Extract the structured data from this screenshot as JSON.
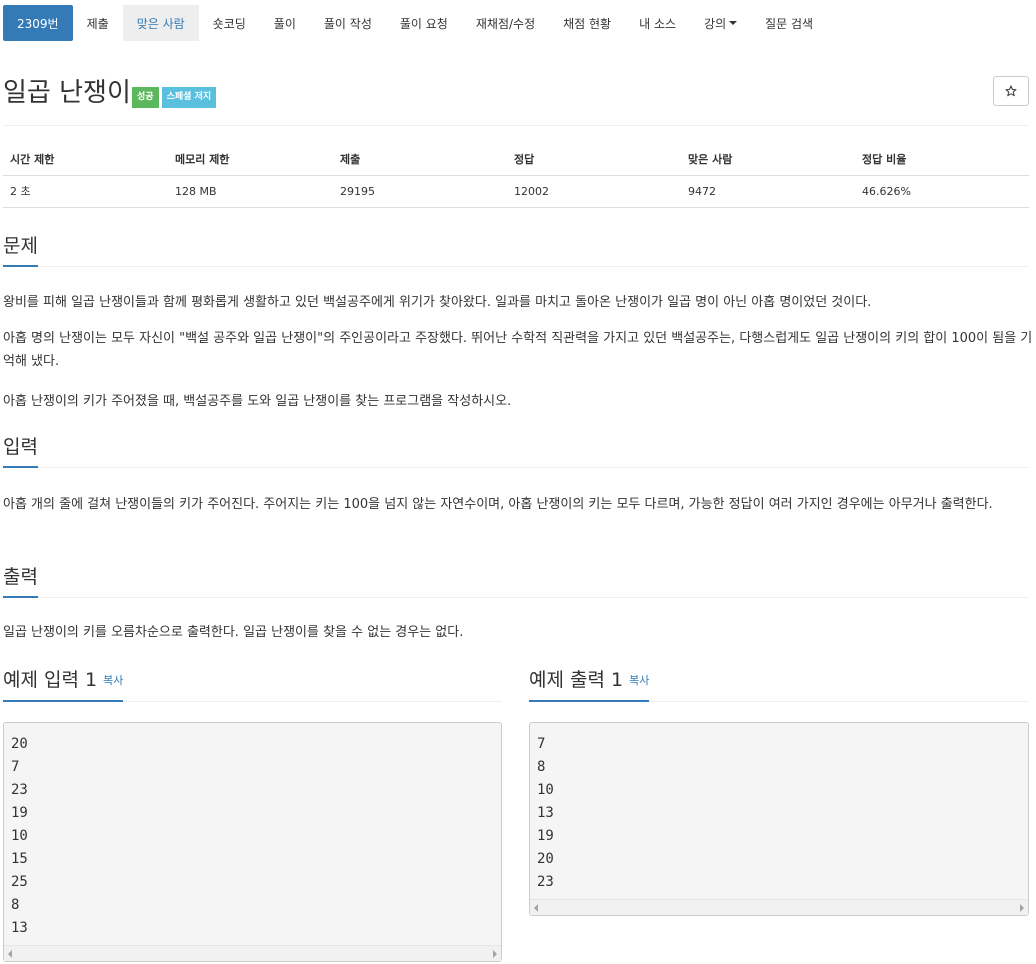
{
  "nav": {
    "items": [
      {
        "label": "2309번",
        "state": "active"
      },
      {
        "label": "제출",
        "state": ""
      },
      {
        "label": "맞은 사람",
        "state": "selected"
      },
      {
        "label": "숏코딩",
        "state": ""
      },
      {
        "label": "풀이",
        "state": ""
      },
      {
        "label": "풀이 작성",
        "state": ""
      },
      {
        "label": "풀이 요청",
        "state": ""
      },
      {
        "label": "재채점/수정",
        "state": ""
      },
      {
        "label": "채점 현황",
        "state": ""
      },
      {
        "label": "내 소스",
        "state": ""
      },
      {
        "label": "강의",
        "state": "dropdown"
      },
      {
        "label": "질문 검색",
        "state": ""
      }
    ]
  },
  "problem": {
    "title": "일곱 난쟁이",
    "labels": [
      "성공",
      "스페셜 저지"
    ],
    "star_icon": "star-outline-icon"
  },
  "info_table": {
    "headers": [
      "시간 제한",
      "메모리 제한",
      "제출",
      "정답",
      "맞은 사람",
      "정답 비율"
    ],
    "values": [
      "2 초",
      "128 MB",
      "29195",
      "12002",
      "9472",
      "46.626%"
    ]
  },
  "sections": {
    "description": {
      "heading": "문제",
      "paragraphs": [
        "왕비를 피해 일곱 난쟁이들과 함께 평화롭게 생활하고 있던 백설공주에게 위기가 찾아왔다. 일과를 마치고 돌아온 난쟁이가 일곱 명이 아닌 아홉 명이었던 것이다.",
        "아홉 명의 난쟁이는 모두 자신이 \"백설 공주와 일곱 난쟁이\"의 주인공이라고 주장했다. 뛰어난 수학적 직관력을 가지고 있던 백설공주는, 다행스럽게도 일곱 난쟁이의 키의 합이 100이 됨을 기억해 냈다.",
        "아홉 난쟁이의 키가 주어졌을 때, 백설공주를 도와 일곱 난쟁이를 찾는 프로그램을 작성하시오."
      ]
    },
    "input": {
      "heading": "입력",
      "text": "아홉 개의 줄에 걸쳐 난쟁이들의 키가 주어진다. 주어지는 키는 100을 넘지 않는 자연수이며, 아홉 난쟁이의 키는 모두 다르며, 가능한 정답이 여러 가지인 경우에는 아무거나 출력한다."
    },
    "output": {
      "heading": "출력",
      "text": "일곱 난쟁이의 키를 오름차순으로 출력한다. 일곱 난쟁이를 찾을 수 없는 경우는 없다."
    }
  },
  "samples": {
    "input": {
      "heading": "예제 입력 1",
      "copy_label": "복사",
      "lines": [
        "20",
        "7",
        "23",
        "19",
        "10",
        "15",
        "25",
        "8",
        "13"
      ]
    },
    "output": {
      "heading": "예제 출력 1",
      "copy_label": "복사",
      "lines": [
        "7",
        "8",
        "10",
        "13",
        "19",
        "20",
        "23"
      ]
    }
  }
}
